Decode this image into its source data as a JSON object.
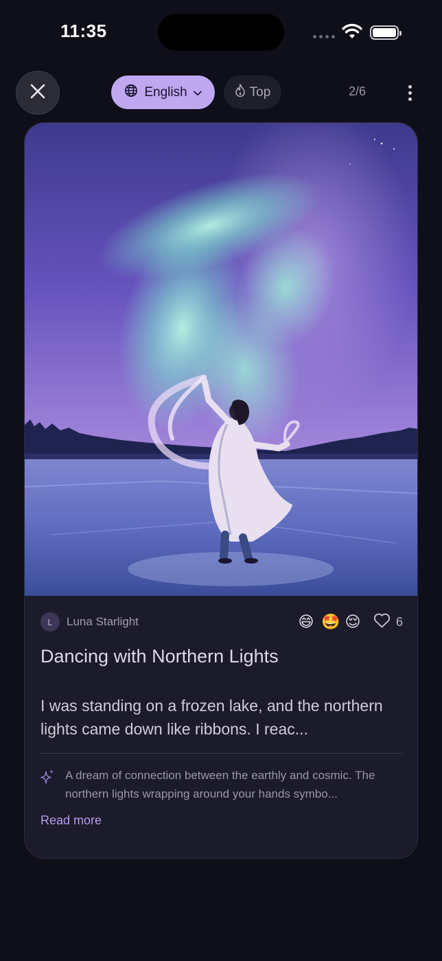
{
  "status_bar": {
    "time": "11:35"
  },
  "toolbar": {
    "language_label": "English",
    "top_label": "Top",
    "pager": "2/6"
  },
  "post": {
    "author_initial": "L",
    "author_name": "Luna Starlight",
    "reactions": [
      "😄",
      "🤩",
      "😌"
    ],
    "likes": "6",
    "title": "Dancing with Northern Lights",
    "excerpt": "I was standing on a frozen lake, and the northern lights came down like ribbons. I reac...",
    "insight": "A dream of connection between the earthly and cosmic. The northern lights wrapping around your hands symbo...",
    "read_more": "Read more"
  },
  "colors": {
    "background": "#0f0f1a",
    "card": "#1c1b2b",
    "accent": "#bfa8f0",
    "link": "#b69cf0"
  },
  "icons": [
    "close-icon",
    "globe-icon",
    "chevron-down-icon",
    "flame-icon",
    "more-vertical-icon",
    "heart-icon",
    "sparkle-icon",
    "wifi-icon",
    "battery-icon"
  ]
}
